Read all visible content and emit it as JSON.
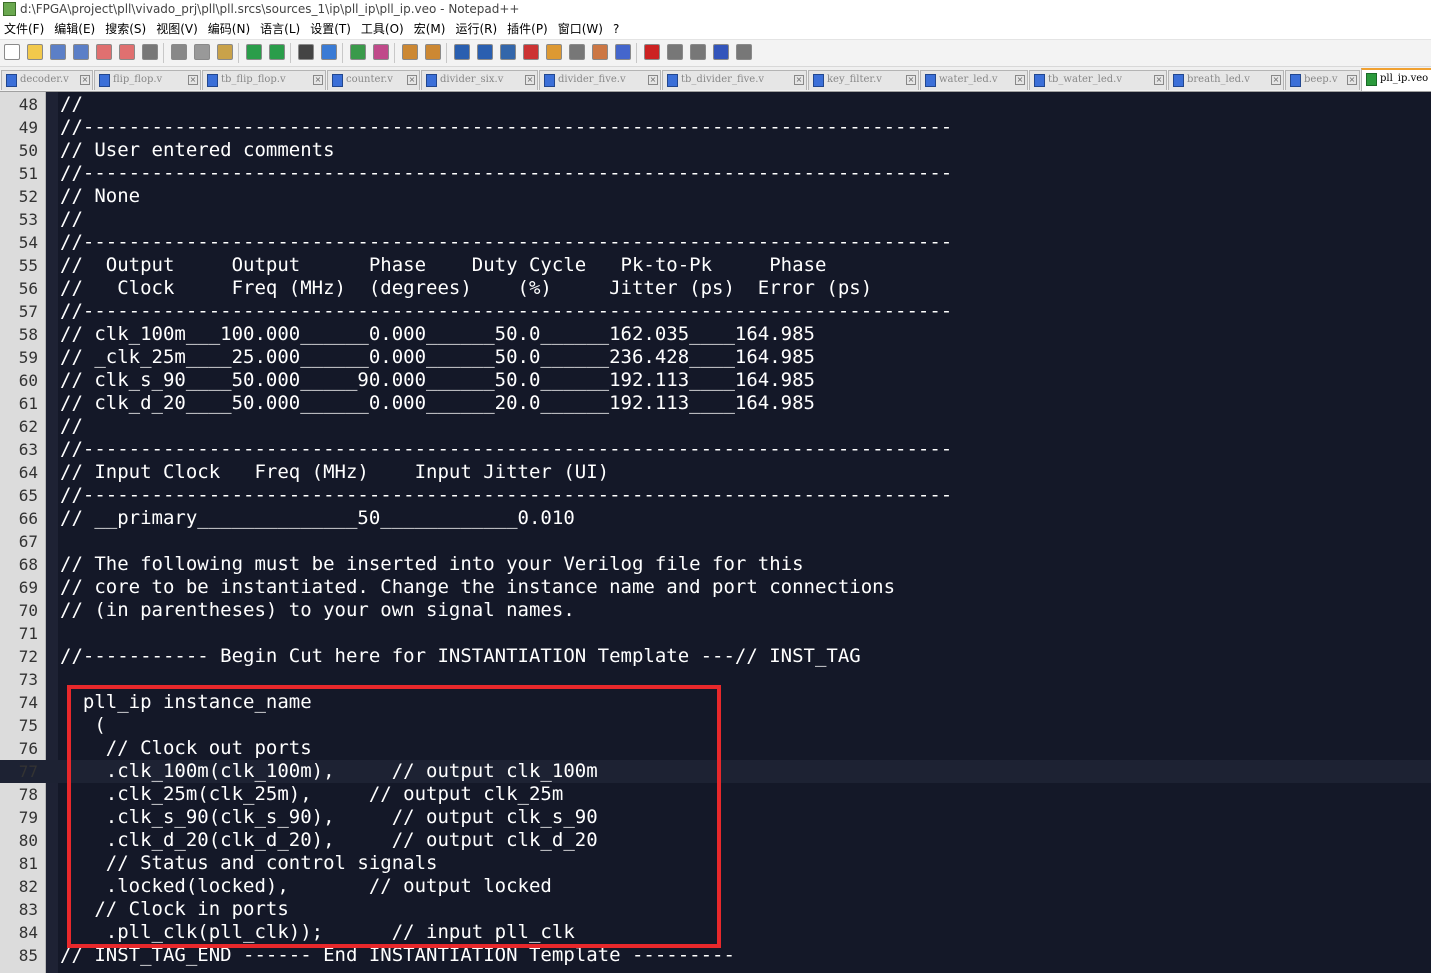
{
  "window": {
    "title": "d:\\FPGA\\project\\pll\\vivado_prj\\pll\\pll.srcs\\sources_1\\ip\\pll_ip\\pll_ip.veo - Notepad++"
  },
  "menu": [
    "文件(F)",
    "编辑(E)",
    "搜索(S)",
    "视图(V)",
    "编码(N)",
    "语言(L)",
    "设置(T)",
    "工具(O)",
    "宏(M)",
    "运行(R)",
    "插件(P)",
    "窗口(W)",
    "?"
  ],
  "toolbar": {
    "buttons": [
      "new-file",
      "open-file",
      "save",
      "save-all",
      "close",
      "close-all",
      "print",
      "cut",
      "copy",
      "paste",
      "undo",
      "redo",
      "find",
      "replace",
      "zoom-in",
      "zoom-out",
      "sync-vertical",
      "sync-horizontal",
      "word-wrap",
      "show-all-chars",
      "indent-guide",
      "user-defined-lang",
      "document-map",
      "function-list",
      "folder-as-workspace",
      "monitoring",
      "record-macro",
      "stop-record",
      "play-macro",
      "run-macro-multiple",
      "save-macro"
    ]
  },
  "tabs": [
    {
      "label": "decoder.v"
    },
    {
      "label": "flip_flop.v"
    },
    {
      "label": "tb_flip_flop.v"
    },
    {
      "label": "counter.v"
    },
    {
      "label": "divider_six.v"
    },
    {
      "label": "divider_five.v"
    },
    {
      "label": "tb_divider_five.v"
    },
    {
      "label": "key_filter.v"
    },
    {
      "label": "water_led.v"
    },
    {
      "label": "tb_water_led.v"
    },
    {
      "label": "breath_led.v"
    },
    {
      "label": "beep.v"
    },
    {
      "label": "pll_ip.veo",
      "active": true
    }
  ],
  "editor": {
    "current_line": 77,
    "lines": [
      {
        "n": "48",
        "text": "//"
      },
      {
        "n": "49",
        "text": "//----------------------------------------------------------------------------"
      },
      {
        "n": "50",
        "text": "// User entered comments"
      },
      {
        "n": "51",
        "text": "//----------------------------------------------------------------------------"
      },
      {
        "n": "52",
        "text": "// None"
      },
      {
        "n": "53",
        "text": "//"
      },
      {
        "n": "54",
        "text": "//----------------------------------------------------------------------------"
      },
      {
        "n": "55",
        "text": "//  Output     Output      Phase    Duty Cycle   Pk-to-Pk     Phase"
      },
      {
        "n": "56",
        "text": "//   Clock     Freq (MHz)  (degrees)    (%)     Jitter (ps)  Error (ps)"
      },
      {
        "n": "57",
        "text": "//----------------------------------------------------------------------------"
      },
      {
        "n": "58",
        "text": "// clk_100m___100.000______0.000______50.0______162.035____164.985"
      },
      {
        "n": "59",
        "text": "// _clk_25m____25.000______0.000______50.0______236.428____164.985"
      },
      {
        "n": "60",
        "text": "// clk_s_90____50.000_____90.000______50.0______192.113____164.985"
      },
      {
        "n": "61",
        "text": "// clk_d_20____50.000______0.000______20.0______192.113____164.985"
      },
      {
        "n": "62",
        "text": "//"
      },
      {
        "n": "63",
        "text": "//----------------------------------------------------------------------------"
      },
      {
        "n": "64",
        "text": "// Input Clock   Freq (MHz)    Input Jitter (UI)"
      },
      {
        "n": "65",
        "text": "//----------------------------------------------------------------------------"
      },
      {
        "n": "66",
        "text": "// __primary______________50____________0.010"
      },
      {
        "n": "67",
        "text": ""
      },
      {
        "n": "68",
        "text": "// The following must be inserted into your Verilog file for this"
      },
      {
        "n": "69",
        "text": "// core to be instantiated. Change the instance name and port connections"
      },
      {
        "n": "70",
        "text": "// (in parentheses) to your own signal names."
      },
      {
        "n": "71",
        "text": ""
      },
      {
        "n": "72",
        "text": "//----------- Begin Cut here for INSTANTIATION Template ---// INST_TAG"
      },
      {
        "n": "73",
        "text": ""
      },
      {
        "n": "74",
        "text": "  pll_ip instance_name"
      },
      {
        "n": "75",
        "text": "   ("
      },
      {
        "n": "76",
        "text": "    // Clock out ports"
      },
      {
        "n": "77",
        "text": "    .clk_100m(clk_100m),     // output clk_100m"
      },
      {
        "n": "78",
        "text": "    .clk_25m(clk_25m),     // output clk_25m"
      },
      {
        "n": "79",
        "text": "    .clk_s_90(clk_s_90),     // output clk_s_90"
      },
      {
        "n": "80",
        "text": "    .clk_d_20(clk_d_20),     // output clk_d_20"
      },
      {
        "n": "81",
        "text": "    // Status and control signals"
      },
      {
        "n": "82",
        "text": "    .locked(locked),       // output locked"
      },
      {
        "n": "83",
        "text": "   // Clock in ports"
      },
      {
        "n": "84",
        "text": "    .pll_clk(pll_clk));      // input pll_clk"
      },
      {
        "n": "85",
        "text": "// INST_TAG_END ------ End INSTANTIATION Template ---------"
      }
    ]
  },
  "colors": {
    "editor_bg": "#141828",
    "code_text": "#ffffff",
    "highlight_box": "#e8282b",
    "active_tab_accent": "#f0a030"
  }
}
